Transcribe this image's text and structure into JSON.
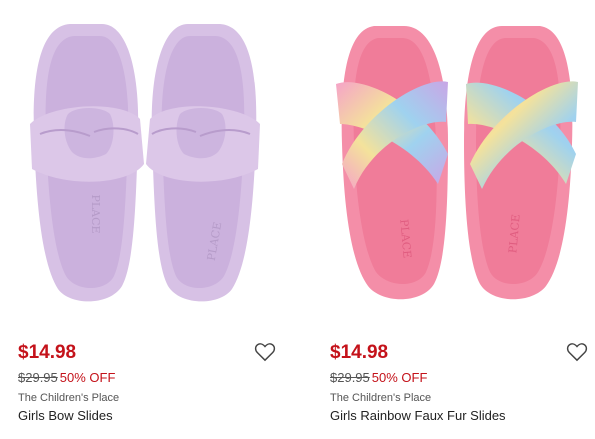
{
  "products": [
    {
      "price": "$14.98",
      "original_price": "$29.95",
      "discount": "50% OFF",
      "brand": "The Children's Place",
      "name": "Girls Bow Slides",
      "sole_print": "PLACE",
      "colors": {
        "strap": "#dcc7e8",
        "sole": "#d7c1e5",
        "sole_inner": "#cbb1dd"
      }
    },
    {
      "price": "$14.98",
      "original_price": "$29.95",
      "discount": "50% OFF",
      "brand": "The Children's Place",
      "name": "Girls Rainbow Faux Fur Slides",
      "sole_print": "PLACE",
      "colors": {
        "sole": "#f48ea8",
        "sole_inner": "#f07c99",
        "fur_pink": "#f5a3c8",
        "fur_yellow": "#f4e29b",
        "fur_blue": "#9fd2ef",
        "fur_purple": "#c9a6e6"
      }
    }
  ],
  "theme": {
    "sale_color": "#c4121a"
  }
}
